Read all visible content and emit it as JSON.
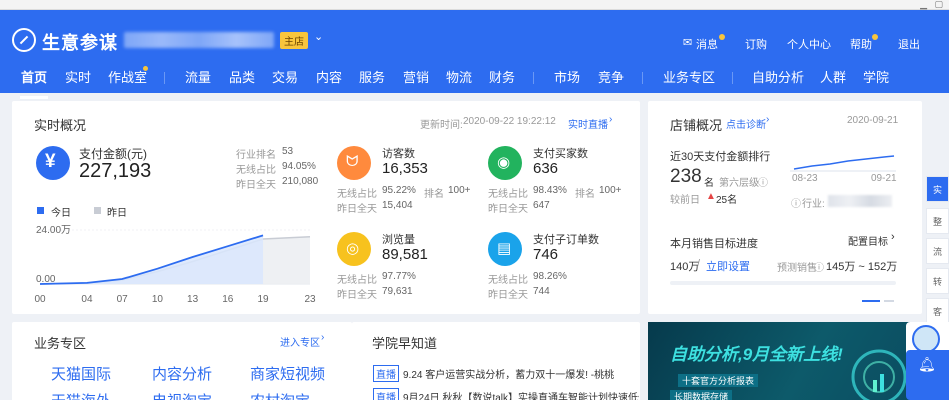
{
  "header": {
    "brand": "生意参谋",
    "shop_badge": "主店",
    "topnav": [
      "消息",
      "订购",
      "个人中心",
      "帮助",
      "退出"
    ],
    "menu": [
      "首页",
      "实时",
      "作战室",
      "流量",
      "品类",
      "交易",
      "内容",
      "服务",
      "营销",
      "物流",
      "财务",
      "市场",
      "竞争",
      "业务专区",
      "自助分析",
      "人群",
      "学院"
    ]
  },
  "realtime": {
    "title": "实时概况",
    "update_label": "更新时间:",
    "update_time": "2020-09-22 19:22:12",
    "live_link": "实时直播",
    "pay_label": "支付金额(元)",
    "pay_value": "227,193",
    "pay_rank_k": "行业排名",
    "pay_rank_v": "53",
    "pay_share_k": "无线占比",
    "pay_share_v": "94.05%",
    "pay_yday_k": "昨日全天",
    "pay_yday_v": "210,080",
    "legend_today": "今日",
    "legend_yday": "昨日",
    "y_max": "24.00万",
    "y_min": "0.00",
    "x_ticks": [
      "00",
      "04",
      "07",
      "10",
      "13",
      "16",
      "19",
      "23"
    ],
    "metrics": [
      {
        "label": "访客数",
        "value": "16,353",
        "k1": "无线占比",
        "v1": "95.22%",
        "k2": "排名",
        "v2": "100+",
        "k3": "昨日全天",
        "v3": "15,404"
      },
      {
        "label": "支付买家数",
        "value": "636",
        "k1": "无线占比",
        "v1": "98.43%",
        "k2": "排名",
        "v2": "100+",
        "k3": "昨日全天",
        "v3": "647"
      },
      {
        "label": "浏览量",
        "value": "89,581",
        "k1": "无线占比",
        "v1": "97.77%",
        "k3": "昨日全天",
        "v3": "79,631"
      },
      {
        "label": "支付子订单数",
        "value": "746",
        "k1": "无线占比",
        "v1": "98.26%",
        "k3": "昨日全天",
        "v3": "744"
      }
    ]
  },
  "chart_data": {
    "type": "area",
    "x": [
      0,
      4,
      7,
      10,
      13,
      16,
      19,
      23
    ],
    "ylim": [
      0,
      240000
    ],
    "series": [
      {
        "name": "今日",
        "values": [
          0,
          5000,
          22000,
          68000,
          120000,
          168000,
          216000,
          227193
        ]
      },
      {
        "name": "昨日",
        "values": [
          0,
          4000,
          18000,
          55000,
          100000,
          150000,
          200000,
          210080
        ]
      }
    ]
  },
  "shop": {
    "title": "店铺概况",
    "diag_link": "点击诊断",
    "date": "2020-09-21",
    "rank_title": "近30天支付金额排行",
    "rank_value": "238",
    "rank_unit": "名",
    "rank_level": "第六层级",
    "compare_label": "较前日",
    "compare_value": "25名",
    "industry_label": "行业:",
    "spark_start": "08-23",
    "spark_end": "09-21",
    "target_title": "本月销售目标进度",
    "target_link": "配置目标",
    "target_value": "140万",
    "target_set": "立即设置",
    "forecast_label": "预测销售",
    "forecast_range": "145万 ~ 152万"
  },
  "biz": {
    "title": "业务专区",
    "enter_link": "进入专区",
    "items": [
      "天猫国际",
      "内容分析",
      "商家短视频",
      "天猫海外",
      "电视淘宝",
      "农村淘宝"
    ]
  },
  "academy": {
    "title": "学院早知道",
    "tag": "直播",
    "items": [
      "9.24 客户运营实战分析，蓄力双十一爆发! -桃桃",
      "9月24日 秋秋【数说talk】实操直通车智能计划快速低价引流"
    ]
  },
  "banner": {
    "headline": "自助分析,9月全新上线!",
    "line1": "十套官方分析报表",
    "line2": "长期数据存储"
  },
  "side_tabs": [
    "实",
    "整",
    "流",
    "转",
    "客"
  ]
}
